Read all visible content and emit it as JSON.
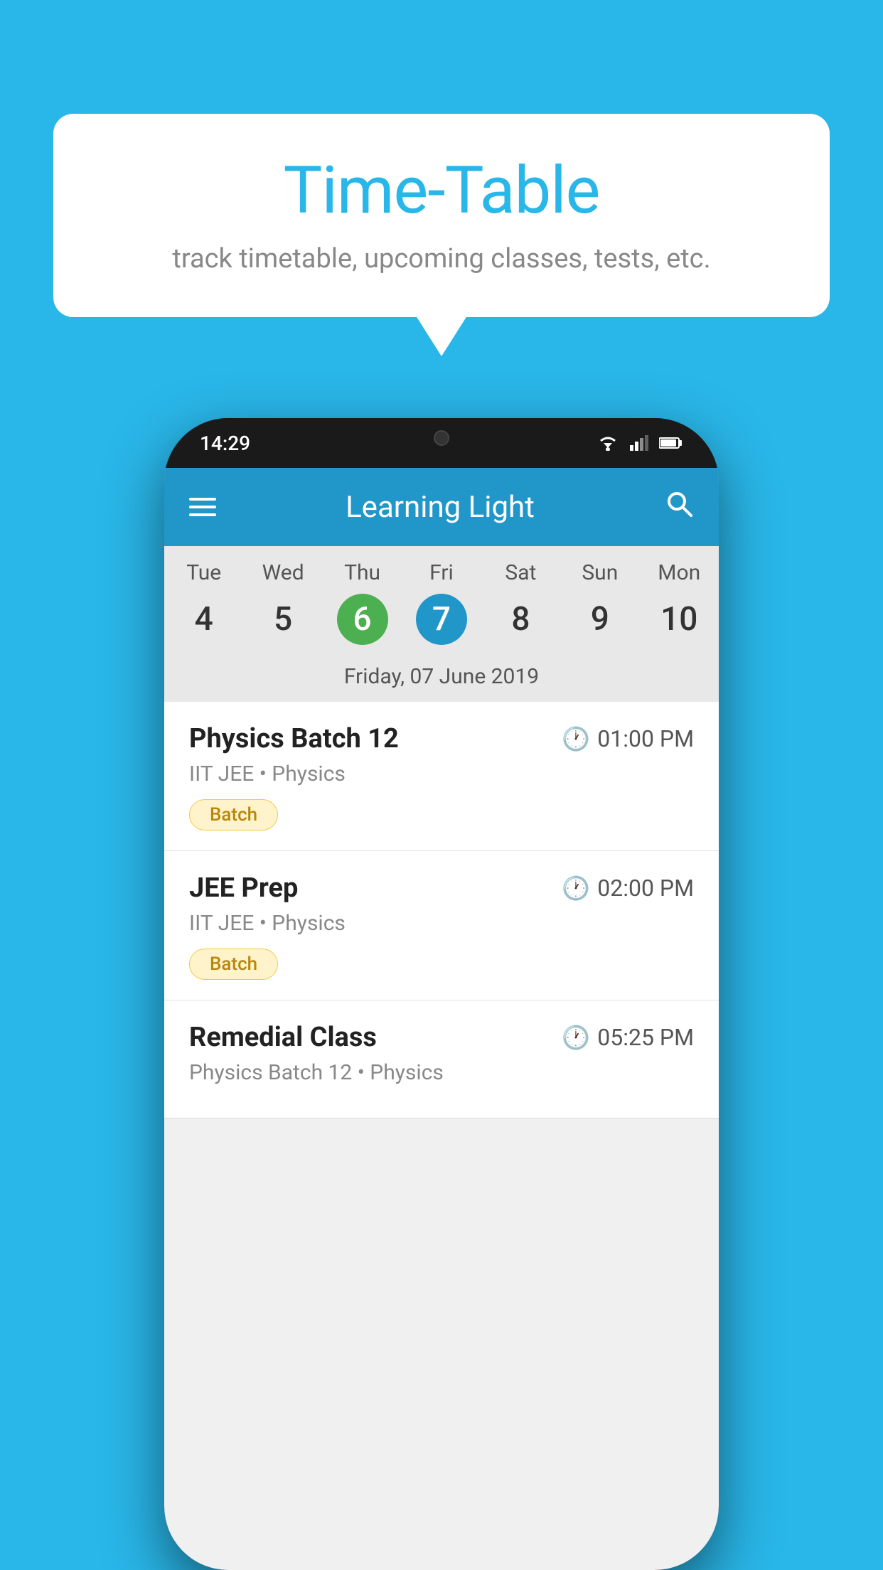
{
  "background_color": "#29B6E8",
  "speech_bubble": {
    "title": "Time-Table",
    "subtitle": "track timetable, upcoming classes, tests, etc."
  },
  "phone": {
    "status_bar": {
      "time": "14:29"
    },
    "app_header": {
      "title": "Learning Light"
    },
    "calendar": {
      "days": [
        {
          "name": "Tue",
          "number": "4",
          "state": "normal"
        },
        {
          "name": "Wed",
          "number": "5",
          "state": "normal"
        },
        {
          "name": "Thu",
          "number": "6",
          "state": "today"
        },
        {
          "name": "Fri",
          "number": "7",
          "state": "selected"
        },
        {
          "name": "Sat",
          "number": "8",
          "state": "normal"
        },
        {
          "name": "Sun",
          "number": "9",
          "state": "normal"
        },
        {
          "name": "Mon",
          "number": "10",
          "state": "normal"
        }
      ],
      "selected_date_label": "Friday, 07 June 2019"
    },
    "schedule": [
      {
        "title": "Physics Batch 12",
        "time": "01:00 PM",
        "subject": "IIT JEE • Physics",
        "badge": "Batch"
      },
      {
        "title": "JEE Prep",
        "time": "02:00 PM",
        "subject": "IIT JEE • Physics",
        "badge": "Batch"
      },
      {
        "title": "Remedial Class",
        "time": "05:25 PM",
        "subject": "Physics Batch 12 • Physics",
        "badge": null
      }
    ]
  }
}
